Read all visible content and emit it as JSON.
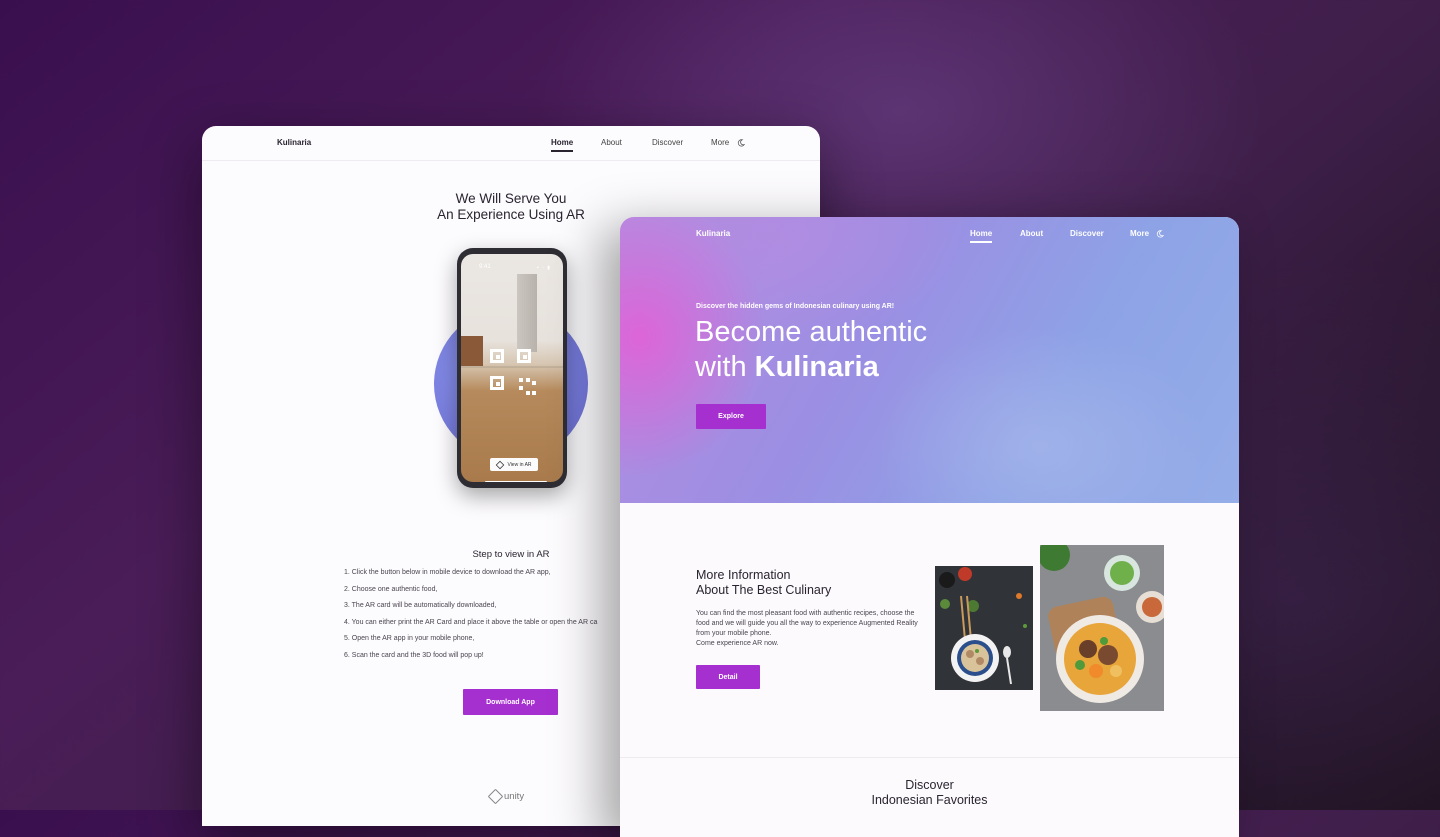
{
  "colors": {
    "accent": "#a62fd0",
    "text": "#2a2430",
    "hero_pink": "#e260d6",
    "hero_blue": "#8da3e6"
  },
  "back_window": {
    "brand": "Kulinaria",
    "nav": [
      "Home",
      "About",
      "Discover",
      "More"
    ],
    "title_line1": "We Will Serve You",
    "title_line2": "An Experience Using AR",
    "phone": {
      "time": "9:41",
      "ar_button": "View in AR",
      "icons": [
        "qr-code-icon",
        "cube-icon"
      ]
    },
    "steps_title": "Step to view in AR",
    "steps": [
      "1. Click the button below in mobile device to download the AR app,",
      "2. Choose one authentic food,",
      "3. The AR card will be automatically downloaded,",
      "4. You can either print the AR Card and place it above the table or open the AR ca",
      "5. Open the AR app in your mobile phone,",
      "6. Scan the card and the 3D food will pop up!"
    ],
    "download_label": "Download App",
    "footer_logo": "unity"
  },
  "front_window": {
    "brand": "Kulinaria",
    "nav": [
      "Home",
      "About",
      "Discover",
      "More"
    ],
    "tagline": "Discover the hidden gems of Indonesian culinary using AR!",
    "headline_line1": "Become authentic",
    "headline_line2_prefix": "with ",
    "headline_line2_bold": "Kulinaria",
    "explore_label": "Explore",
    "info_title_line1": "More Information",
    "info_title_line2": "About The Best Culinary",
    "info_body": "You can find the most pleasant food with authentic recipes, choose the food and we will guide you all the way to experience Augmented Reality from your mobile phone.",
    "info_body_2": "Come experience AR now.",
    "detail_label": "Detail",
    "discover_line1": "Discover",
    "discover_line2": "Indonesian Favorites"
  }
}
